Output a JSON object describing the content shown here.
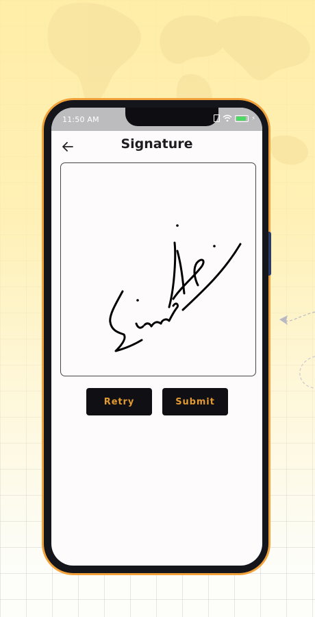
{
  "status_bar": {
    "time": "11:50 AM",
    "icons": [
      "sim-icon",
      "wifi-icon",
      "battery-icon",
      "charging-icon"
    ],
    "battery_color": "#4cd964"
  },
  "header": {
    "title": "Signature",
    "back_icon": "arrow-left-icon"
  },
  "signature_pad": {
    "has_signature": true
  },
  "actions": {
    "retry_label": "Retry",
    "submit_label": "Submit"
  },
  "colors": {
    "phone_frame": "#f2a23a",
    "button_bg": "#0f0f14",
    "button_text": "#e29a33",
    "background_accent": "#ffeca0"
  }
}
